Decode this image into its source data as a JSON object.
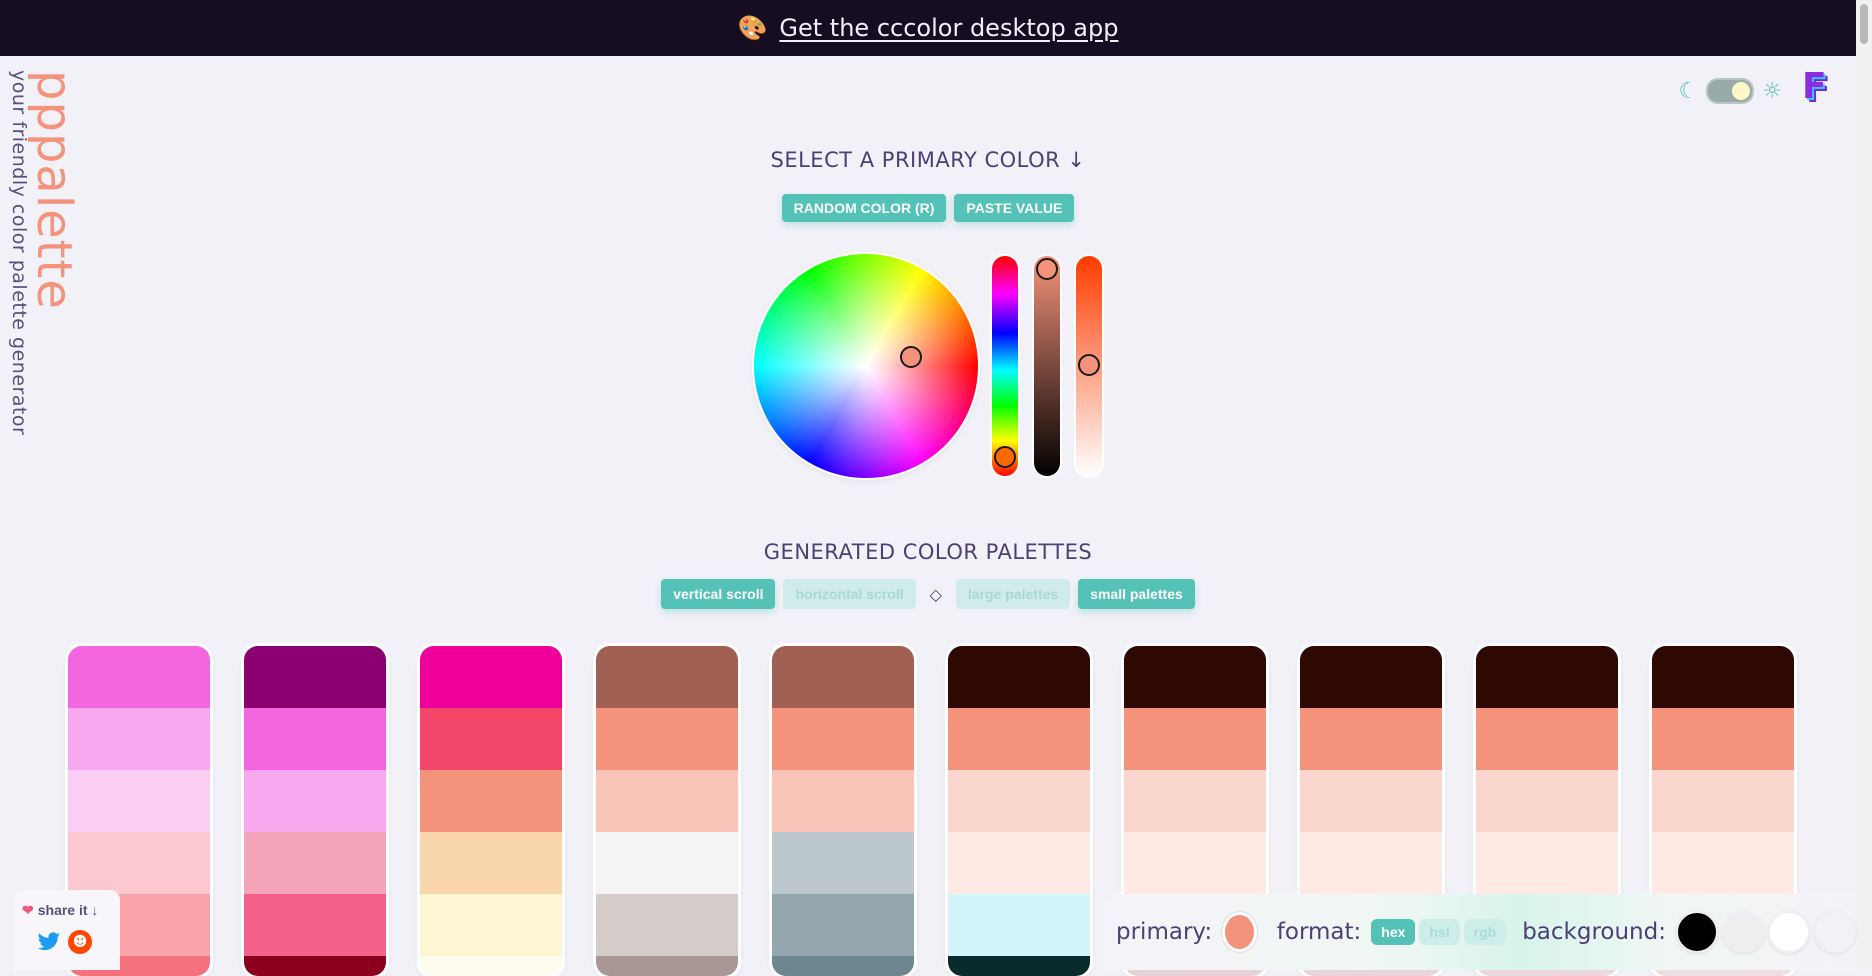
{
  "banner": {
    "icon": "palette-icon",
    "link": "Get the cccolor desktop app"
  },
  "brand": {
    "logo": "pppalette",
    "tagline": "your friendly color palette generator"
  },
  "theme": {
    "moon": "☾",
    "sun": "☼"
  },
  "primary_section": {
    "title": "SELECT A PRIMARY COLOR ↓",
    "random_label": "RANDOM COLOR (R)",
    "paste_label": "PASTE VALUE"
  },
  "generated": {
    "title": "GENERATED COLOR PALETTES",
    "vertical": "vertical scroll",
    "horizontal": "horizontal scroll",
    "divider": "◇",
    "large": "large palettes",
    "small": "small palettes"
  },
  "palettes": [
    [
      "#f366e0",
      "#f8a8ef",
      "#fbcdf5",
      "#fbc9cf",
      "#f7a3a9",
      "#f4717d"
    ],
    [
      "#8b0070",
      "#f366e0",
      "#f8a8ef",
      "#f5a3b9",
      "#f4618b",
      "#8b001f"
    ],
    [
      "#f0009a",
      "#f34669",
      "#f4937b",
      "#f9d6ab",
      "#fdf6d2",
      "#fdfcee"
    ],
    [
      "#a06052",
      "#f4937b",
      "#f8c4b8",
      "#f4f4f4",
      "#d4cbca",
      "#a89794"
    ],
    [
      "#a06052",
      "#f4937b",
      "#f8c4b8",
      "#bcc8cd",
      "#93a6ae",
      "#6e8690"
    ],
    [
      "#2f0703",
      "#f4937b",
      "#fbd6cd",
      "#ffe9e4",
      "#d2f5f9",
      "#0a2b2e"
    ],
    [
      "#2f0703",
      "#f4937b",
      "#fbd6cd",
      "#ffe9e4",
      "#f5e3e6",
      "#e7d3d7"
    ],
    [
      "#2f0703",
      "#f4937b",
      "#fbd6cd",
      "#ffe9e4",
      "#f4e3e8",
      "#e9d4dd"
    ],
    [
      "#2f0703",
      "#f4937b",
      "#fbd6cd",
      "#ffe9e4",
      "#f6e6ea",
      "#ecd8de"
    ],
    [
      "#2f0703",
      "#f4937b",
      "#fbd6cd",
      "#ffe9e4",
      "#f6e7ea",
      "#eedde1"
    ]
  ],
  "share": {
    "label": "share it ↓"
  },
  "controls": {
    "primary_label": "primary:",
    "primary_color": "#f4937b",
    "format_label": "format:",
    "formats": [
      "hex",
      "hsl",
      "rgb"
    ],
    "background_label": "background:",
    "backgrounds": [
      "#000000",
      "#eeeeee",
      "#ffffff",
      "#f3f1f8"
    ]
  },
  "accent": "#54c2b6"
}
